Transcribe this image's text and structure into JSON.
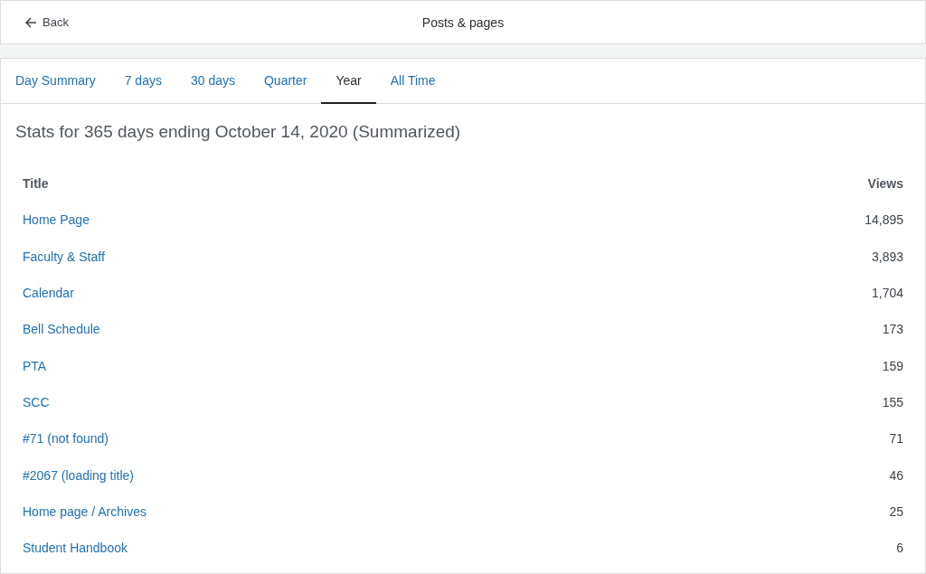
{
  "header": {
    "back_label": "Back",
    "title": "Posts & pages"
  },
  "tabs": [
    {
      "label": "Day Summary",
      "selected": false
    },
    {
      "label": "7 days",
      "selected": false
    },
    {
      "label": "30 days",
      "selected": false
    },
    {
      "label": "Quarter",
      "selected": false
    },
    {
      "label": "Year",
      "selected": true
    },
    {
      "label": "All Time",
      "selected": false
    }
  ],
  "heading": "Stats for 365 days ending October 14, 2020 (Summarized)",
  "table": {
    "columns": [
      "Title",
      "Views"
    ],
    "rows": [
      {
        "title": "Home Page",
        "views": "14,895"
      },
      {
        "title": "Faculty & Staff",
        "views": "3,893"
      },
      {
        "title": "Calendar",
        "views": "1,704"
      },
      {
        "title": "Bell Schedule",
        "views": "173"
      },
      {
        "title": "PTA",
        "views": "159"
      },
      {
        "title": "SCC",
        "views": "155"
      },
      {
        "title": "#71 (not found)",
        "views": "71"
      },
      {
        "title": "#2067 (loading title)",
        "views": "46"
      },
      {
        "title": "Home page / Archives",
        "views": "25"
      },
      {
        "title": "Student Handbook",
        "views": "6"
      }
    ]
  }
}
